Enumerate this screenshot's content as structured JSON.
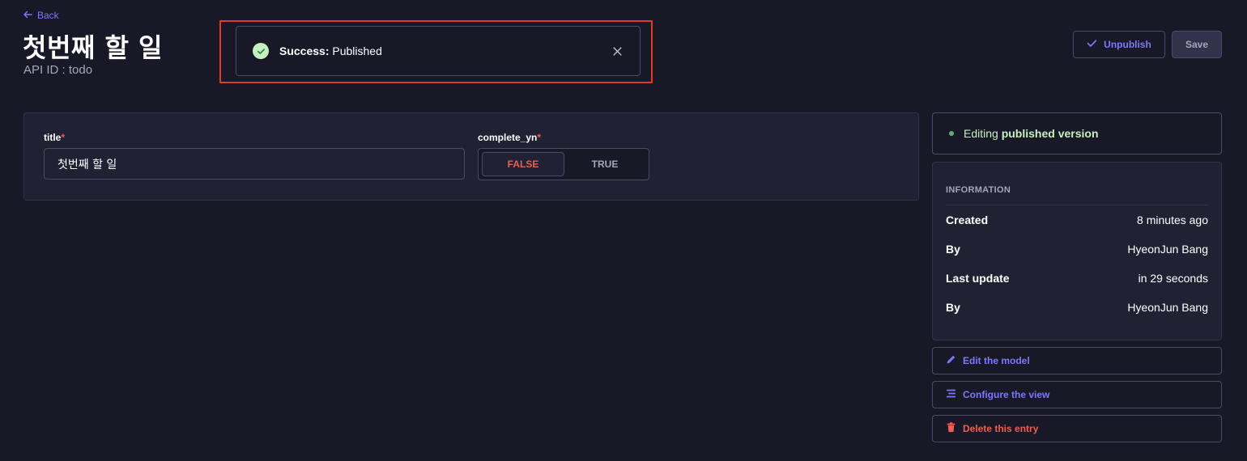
{
  "header": {
    "back_label": "Back",
    "title": "첫번째 할 일",
    "api_id": "API ID : todo",
    "unpublish_label": "Unpublish",
    "save_label": "Save"
  },
  "toast": {
    "status": "Success:",
    "message": "Published"
  },
  "form": {
    "title_label": "title",
    "title_value": "첫번째 할 일",
    "complete_label": "complete_yn",
    "required_mark": "*",
    "toggle_false": "FALSE",
    "toggle_true": "TRUE",
    "selected": "FALSE"
  },
  "sidebar": {
    "status_prefix": "Editing",
    "status_bold": "published version",
    "info_heading": "INFORMATION",
    "info_rows": [
      {
        "key": "Created",
        "value": "8 minutes ago"
      },
      {
        "key": "By",
        "value": "HyeonJun Bang"
      },
      {
        "key": "Last update",
        "value": "in 29 seconds"
      },
      {
        "key": "By",
        "value": "HyeonJun Bang"
      }
    ],
    "edit_model_label": "Edit the model",
    "configure_view_label": "Configure the view",
    "delete_entry_label": "Delete this entry"
  },
  "colors": {
    "background": "#181826",
    "card": "#212134",
    "accent": "#7b79ff",
    "danger": "#ee5e52",
    "success": "#c6f0c2",
    "highlight": "#e13b2b"
  },
  "icons": [
    "arrow-left-icon",
    "check-circle-icon",
    "close-icon",
    "check-icon",
    "pencil-icon",
    "list-icon",
    "trash-icon"
  ]
}
